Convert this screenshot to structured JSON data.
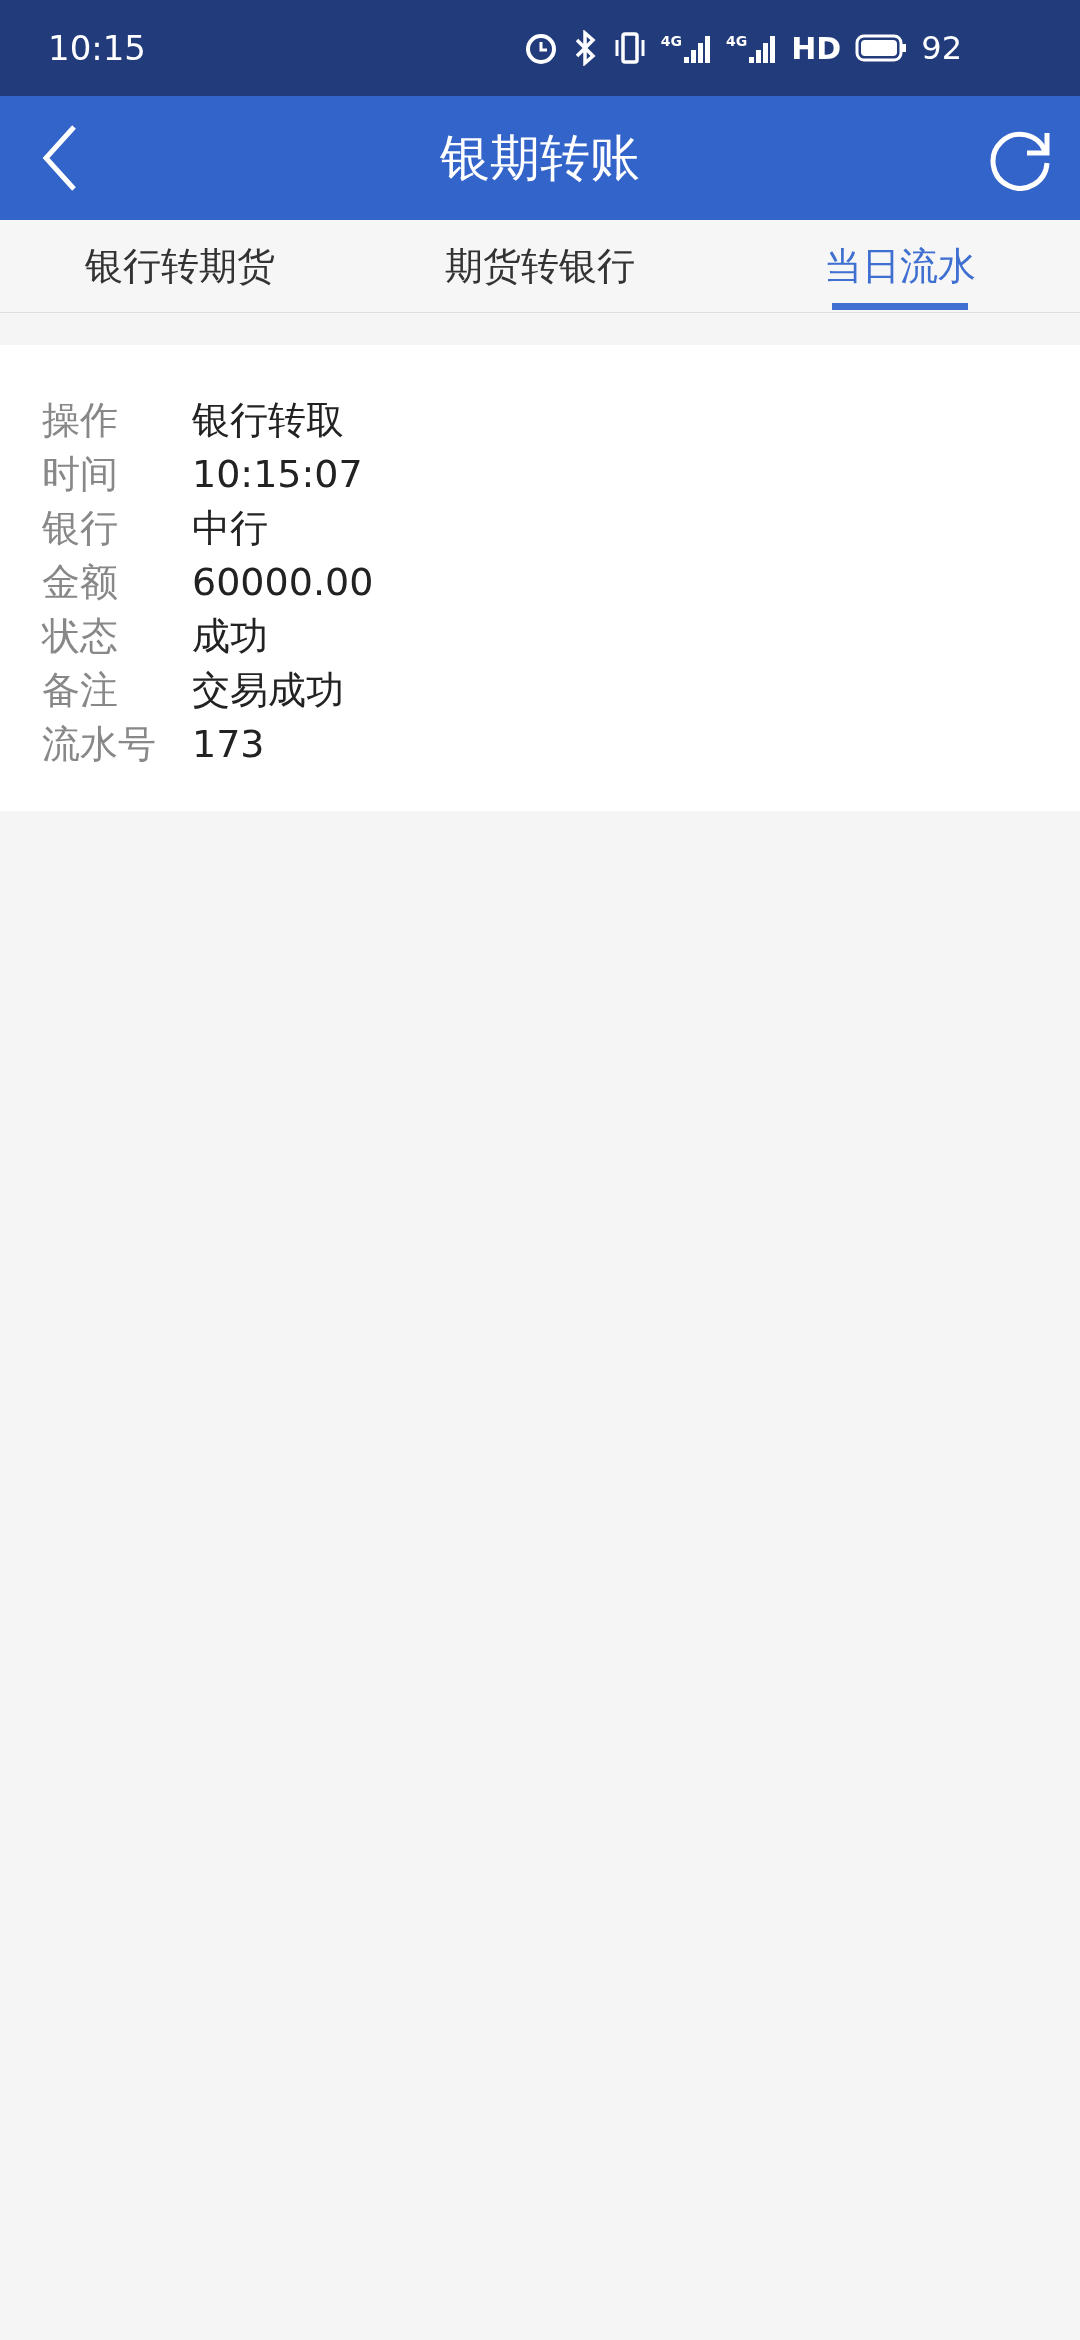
{
  "status_bar": {
    "time": "10:15",
    "signals": [
      {
        "network": "4G"
      },
      {
        "network": "4G"
      }
    ],
    "hd": "HD",
    "battery": "92"
  },
  "header": {
    "title": "银期转账"
  },
  "tabs": [
    {
      "label": "银行转期货",
      "selected": false
    },
    {
      "label": "期货转银行",
      "selected": false
    },
    {
      "label": "当日流水",
      "selected": true
    }
  ],
  "record": [
    {
      "label": "操作",
      "value": "银行转取"
    },
    {
      "label": "时间",
      "value": "10:15:07"
    },
    {
      "label": "银行",
      "value": "中行"
    },
    {
      "label": "金额",
      "value": "60000.00"
    },
    {
      "label": "状态",
      "value": "成功"
    },
    {
      "label": "备注",
      "value": "交易成功"
    },
    {
      "label": "流水号",
      "value": "173"
    }
  ]
}
